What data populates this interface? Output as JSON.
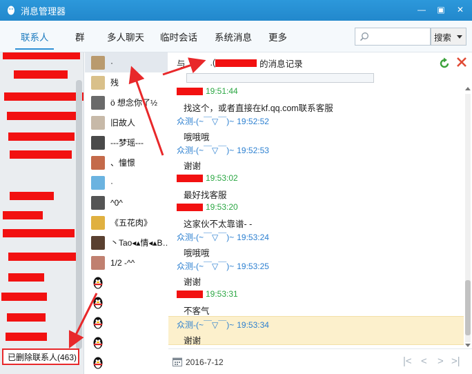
{
  "window": {
    "title": "消息管理器",
    "min_glyph": "—",
    "restore_glyph": "▣",
    "close_glyph": "✕"
  },
  "nav": {
    "tabs": [
      {
        "label": "联系人",
        "active": true
      },
      {
        "label": "群"
      },
      {
        "label": "多人聊天"
      },
      {
        "label": "临时会话"
      },
      {
        "label": "系统消息"
      },
      {
        "label": "更多"
      }
    ],
    "search_placeholder": "",
    "search_button": "搜索"
  },
  "groups": {
    "deleted_label": "已删除联系人(463)"
  },
  "contacts": [
    {
      "name": "·",
      "avatar": "photo"
    },
    {
      "name": "残",
      "avatar": "photo"
    },
    {
      "name": "ö 想念你了½",
      "avatar": "photo"
    },
    {
      "name": "旧故人",
      "avatar": "photo"
    },
    {
      "name": "---梦瑶---",
      "avatar": "photo"
    },
    {
      "name": "、憧憬",
      "avatar": "photo"
    },
    {
      "name": "·",
      "avatar": "photo"
    },
    {
      "name": "^0^",
      "avatar": "photo"
    },
    {
      "name": "《五花肉》",
      "avatar": "photo"
    },
    {
      "name": "丶Tao◂▴情◂▴B…",
      "avatar": "photo"
    },
    {
      "name": "1/2 -^^",
      "avatar": "photo"
    },
    {
      "name": "",
      "avatar": "penguin"
    },
    {
      "name": "",
      "avatar": "penguin"
    },
    {
      "name": "",
      "avatar": "penguin"
    },
    {
      "name": "",
      "avatar": "penguin"
    },
    {
      "name": "",
      "avatar": "penguin"
    }
  ],
  "header": {
    "prefix": "与",
    "dot": ".(",
    "record_label": "的消息记录"
  },
  "messages": [
    {
      "sender": "",
      "color": "green",
      "time": "19:51:44",
      "text": "找这个，或者直接在kf.qq.com联系客服",
      "highlight": false
    },
    {
      "sender": "众测-(~￣▽￣)~",
      "color": "blue",
      "time": "19:52:52",
      "text": "哦哦哦",
      "highlight": false
    },
    {
      "sender": "众测-(~￣▽￣)~",
      "color": "blue",
      "time": "19:52:53",
      "text": "谢谢",
      "highlight": false
    },
    {
      "sender": "",
      "color": "green",
      "time": "19:53:02",
      "text": "最好找客服",
      "highlight": false
    },
    {
      "sender": "",
      "color": "green",
      "time": "19:53:20",
      "text": "这家伙不太靠谱- -",
      "highlight": false
    },
    {
      "sender": "众测-(~￣▽￣)~",
      "color": "blue",
      "time": "19:53:24",
      "text": "哦哦哦",
      "highlight": false
    },
    {
      "sender": "众测-(~￣▽￣)~",
      "color": "blue",
      "time": "19:53:25",
      "text": "谢谢",
      "highlight": false
    },
    {
      "sender": "",
      "color": "green",
      "time": "19:53:31",
      "text": "不客气",
      "highlight": false
    },
    {
      "sender": "众测-(~￣▽￣)~",
      "color": "blue",
      "time": "19:53:34",
      "text": "谢谢",
      "highlight": true
    }
  ],
  "footer": {
    "date": "2016-7-12",
    "first": "|<",
    "prev": "<",
    "next": ">",
    "last": ">|"
  },
  "colors": {
    "titlebar": "#2288cc",
    "active_tab": "#1d7bbf",
    "sender_self": "#2aa642",
    "sender_other": "#2b7fd0",
    "redaction": "#f21111",
    "highlight_row": "#fcf0cc"
  }
}
